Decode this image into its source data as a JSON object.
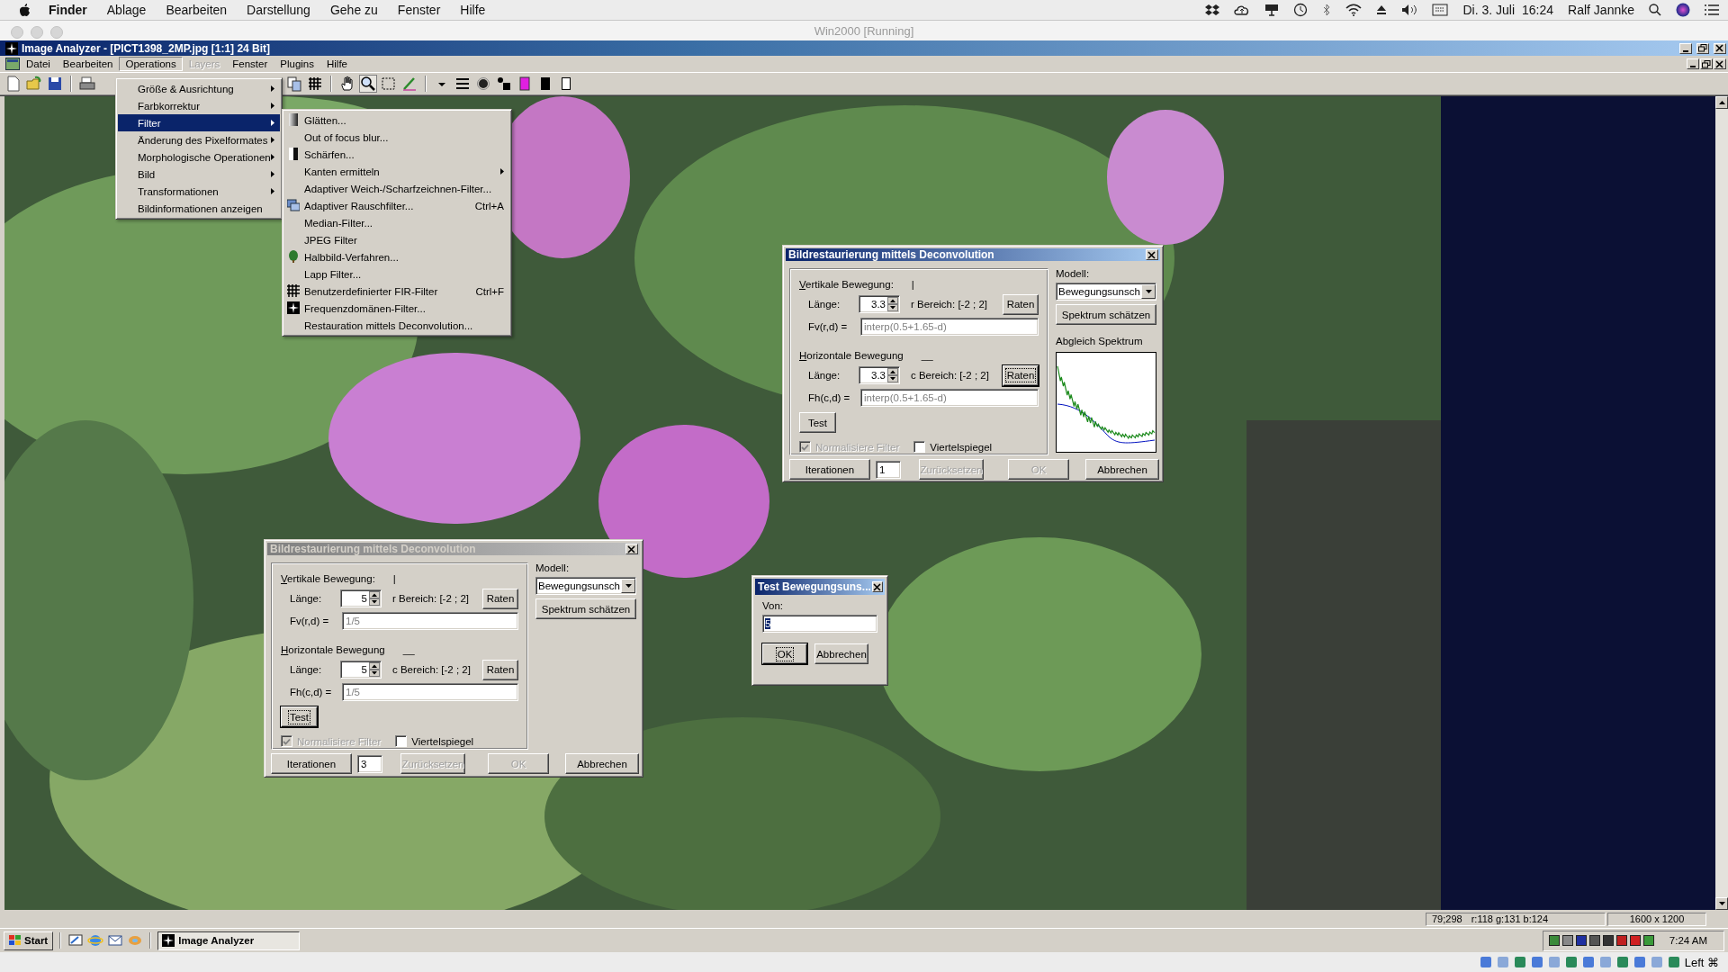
{
  "mac_menubar": {
    "app_name": "Finder",
    "menus": [
      "Ablage",
      "Bearbeiten",
      "Darstellung",
      "Gehe zu",
      "Fenster",
      "Hilfe"
    ],
    "date": "Di. 3. Juli",
    "time": "16:24",
    "user": "Ralf Jannke"
  },
  "vm_window": {
    "title": "Win2000 [Running]"
  },
  "app_window": {
    "title": "Image Analyzer - [PICT1398_2MP.jpg [1:1] 24 Bit]",
    "menus": [
      {
        "label": "Datei",
        "selected": false,
        "disabled": false
      },
      {
        "label": "Bearbeiten",
        "selected": false,
        "disabled": false
      },
      {
        "label": "Operations",
        "selected": true,
        "disabled": false
      },
      {
        "label": "Layers",
        "selected": false,
        "disabled": true
      },
      {
        "label": "Fenster",
        "selected": false,
        "disabled": false
      },
      {
        "label": "Plugins",
        "selected": false,
        "disabled": false
      },
      {
        "label": "Hilfe",
        "selected": false,
        "disabled": false
      }
    ]
  },
  "operations_menu": [
    {
      "label": "Größe & Ausrichtung",
      "has_submenu": true,
      "selected": false
    },
    {
      "label": "Farbkorrektur",
      "has_submenu": true,
      "selected": false
    },
    {
      "label": "Filter",
      "has_submenu": true,
      "selected": true
    },
    {
      "label": "Änderung des Pixelformates",
      "has_submenu": true,
      "selected": false
    },
    {
      "label": "Morphologische Operationen",
      "has_submenu": true,
      "selected": false
    },
    {
      "label": "Bild",
      "has_submenu": true,
      "selected": false
    },
    {
      "label": "Transformationen",
      "has_submenu": true,
      "selected": false
    },
    {
      "label": "Bildinformationen anzeigen",
      "has_submenu": false,
      "selected": false
    }
  ],
  "filter_submenu": [
    {
      "label": "Glätten...",
      "kind": "gradient",
      "has_submenu": false
    },
    {
      "label": "Out of focus blur...",
      "kind": "plain",
      "has_submenu": false
    },
    {
      "label": "Schärfen...",
      "kind": "contrast",
      "has_submenu": false
    },
    {
      "label": "Kanten ermitteln",
      "kind": "plain",
      "has_submenu": true
    },
    {
      "label": "Adaptiver Weich-/Scharfzeichnen-Filter...",
      "kind": "plain",
      "has_submenu": false
    },
    {
      "label": "Adaptiver Rauschfilter...",
      "kind": "windows",
      "shortcut": "Ctrl+A",
      "has_submenu": false
    },
    {
      "label": "Median-Filter...",
      "kind": "plain",
      "has_submenu": false
    },
    {
      "label": "JPEG Filter",
      "kind": "plain",
      "has_submenu": false
    },
    {
      "label": "Halbbild-Verfahren...",
      "kind": "tree",
      "has_submenu": false
    },
    {
      "label": "Lapp Filter...",
      "kind": "plain",
      "has_submenu": false
    },
    {
      "label": "Benutzerdefinierter FIR-Filter",
      "kind": "grid",
      "shortcut": "Ctrl+F",
      "has_submenu": false
    },
    {
      "label": "Frequenzdomänen-Filter...",
      "kind": "star",
      "has_submenu": false
    },
    {
      "label": "Restauration mittels Deconvolution...",
      "kind": "plain",
      "has_submenu": false
    }
  ],
  "deconvolution_dialogs": [
    {
      "title": "Bildrestaurierung mittels Deconvolution",
      "active": true,
      "vertical": {
        "heading": "Vertikale Bewegung:",
        "indicator": "|",
        "length_label": "Länge:",
        "length": "3.3",
        "range": "r Bereich: [-2 ; 2]",
        "guess": {
          "label": "Raten",
          "focused": false
        },
        "formula_label": "Fv(r,d) =",
        "formula": "interp(0.5+1.65-d)"
      },
      "horizontal": {
        "heading": "Horizontale Bewegung",
        "indicator": "__",
        "length_label": "Länge:",
        "length": "3.3",
        "range": "c Bereich: [-2 ; 2]",
        "guess": {
          "label": "Raten",
          "focused": true
        },
        "formula_label": "Fh(c,d) =",
        "formula": "interp(0.5+1.65-d)"
      },
      "test": {
        "label": "Test",
        "focused": false
      },
      "checkboxes": [
        {
          "label": "Normalisiere Filter",
          "checked": true,
          "disabled": true
        },
        {
          "label": "Viertelspiegel",
          "checked": false,
          "disabled": false
        }
      ],
      "model_label": "Modell:",
      "model": "Bewegungsunsch",
      "estimate": "Spektrum schätzen",
      "spectrum_label": "Abgleich Spektrum",
      "iterations_button": "Iterationen",
      "iterations": "1",
      "reset": {
        "label": "Zurücksetzen",
        "disabled": true
      },
      "ok": {
        "label": "OK",
        "disabled": true
      },
      "cancel": {
        "label": "Abbrechen",
        "disabled": false
      }
    },
    {
      "title": "Bildrestaurierung mittels Deconvolution",
      "active": false,
      "vertical": {
        "heading": "Vertikale Bewegung:",
        "indicator": "|",
        "length_label": "Länge:",
        "length": "5",
        "range": "r Bereich: [-2 ; 2]",
        "guess": {
          "label": "Raten",
          "focused": false
        },
        "formula_label": "Fv(r,d) =",
        "formula": "1/5"
      },
      "horizontal": {
        "heading": "Horizontale Bewegung",
        "indicator": "__",
        "length_label": "Länge:",
        "length": "5",
        "range": "c Bereich: [-2 ; 2]",
        "guess": {
          "label": "Raten",
          "focused": false
        },
        "formula_label": "Fh(c,d) =",
        "formula": "1/5"
      },
      "test": {
        "label": "Test",
        "focused": true
      },
      "checkboxes": [
        {
          "label": "Normalisiere Filter",
          "checked": true,
          "disabled": true
        },
        {
          "label": "Viertelspiegel",
          "checked": false,
          "disabled": false
        }
      ],
      "model_label": "Modell:",
      "model": "Bewegungsunsch",
      "estimate": "Spektrum schätzen",
      "iterations_button": "Iterationen",
      "iterations": "3",
      "reset": {
        "label": "Zurücksetzen",
        "disabled": true
      },
      "ok": {
        "label": "OK",
        "disabled": true
      },
      "cancel": {
        "label": "Abbrechen",
        "disabled": false
      }
    }
  ],
  "test_dialog": {
    "title": "Test Bewegungsuns...",
    "value_label": "Von:",
    "value": "5",
    "value_selected": true,
    "ok": {
      "label": "OK",
      "focused": true
    },
    "cancel": {
      "label": "Abbrechen",
      "focused": false
    }
  },
  "status_bar": {
    "position": "79;298",
    "pixel_value": "r:118 g:131 b:124",
    "image_size": "1600 x 1200"
  },
  "taskbar": {
    "start": "Start",
    "tasks": [
      {
        "label": "Image Analyzer",
        "selected": true
      }
    ],
    "clock": "7:24 AM"
  },
  "vm_statusbar": {
    "host_key": "Left ⌘"
  }
}
